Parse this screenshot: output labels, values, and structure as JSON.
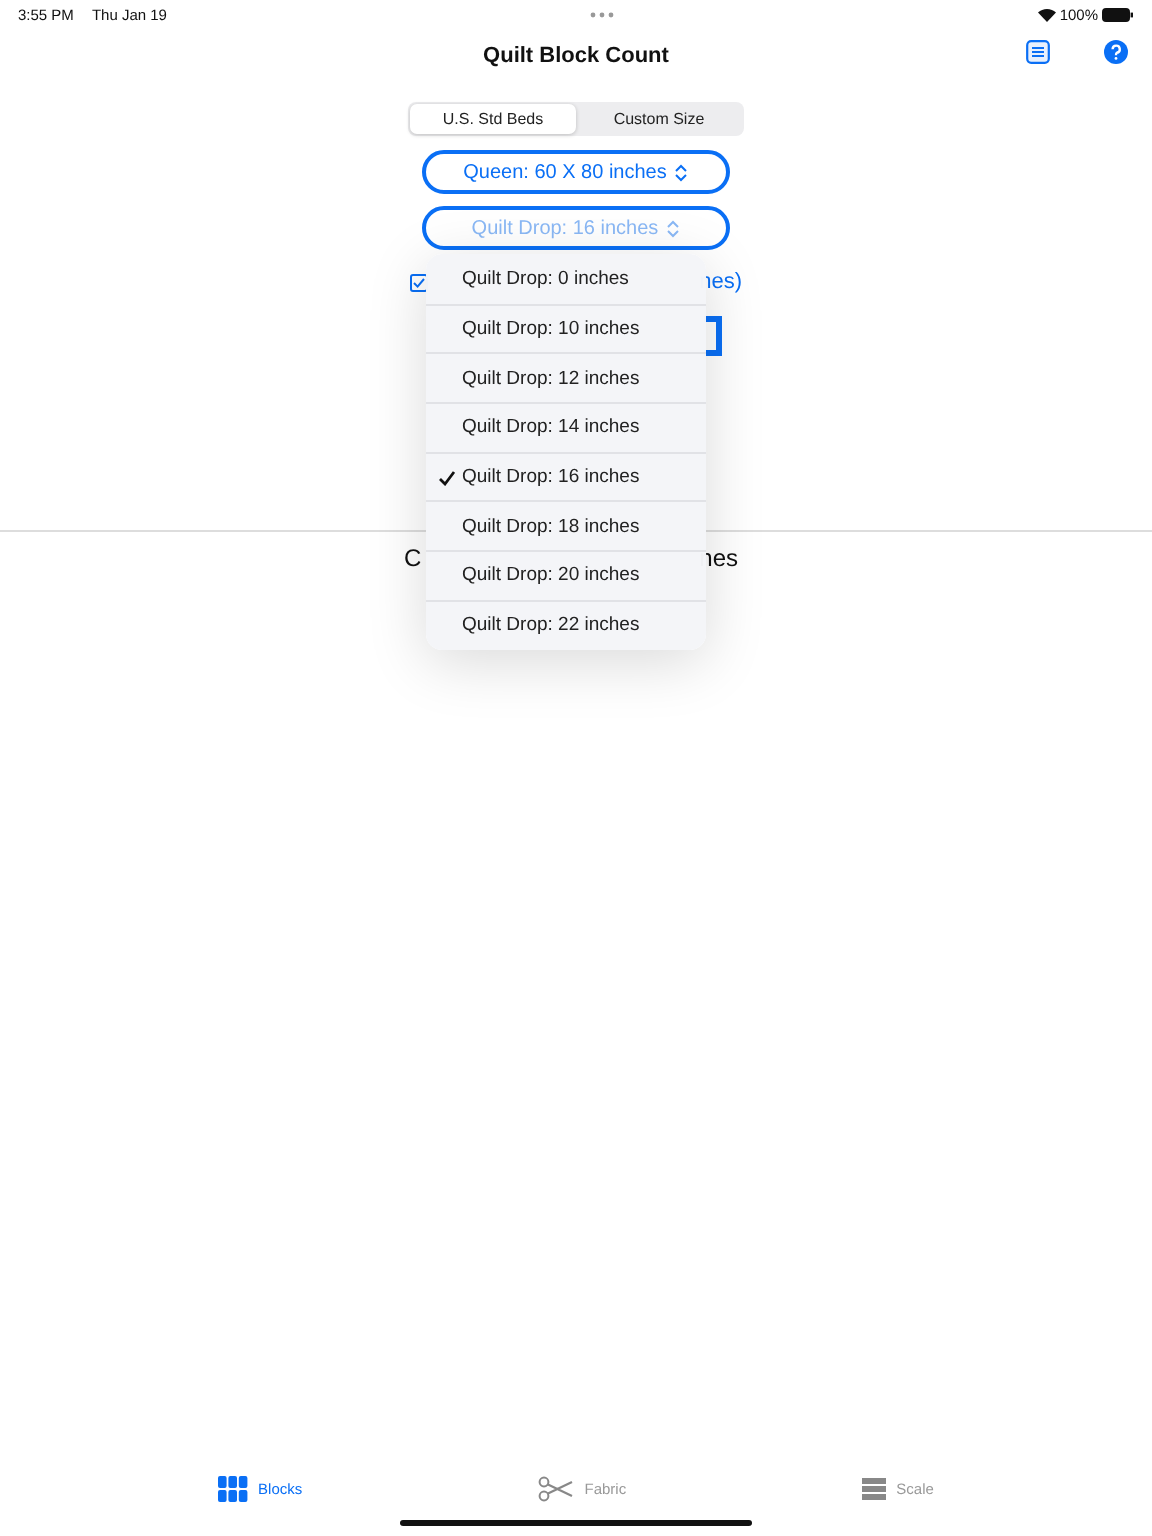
{
  "status_bar": {
    "time": "3:55 PM",
    "date": "Thu Jan 19",
    "battery": "100%"
  },
  "nav": {
    "title": "Quilt Block Count"
  },
  "segments": [
    {
      "label": "U.S. Std Beds",
      "selected": true
    },
    {
      "label": "Custom Size",
      "selected": false
    }
  ],
  "bed_button": {
    "label": "Queen: 60 X 80 inches"
  },
  "drop_button": {
    "label": "Quilt Drop: 16 inches"
  },
  "option": {
    "checked": true,
    "label_end": "nes)"
  },
  "result": {
    "start": "C",
    "end": "nes"
  },
  "menu": [
    {
      "label": "Quilt Drop: 0 inches",
      "selected": false
    },
    {
      "label": "Quilt Drop: 10 inches",
      "selected": false
    },
    {
      "label": "Quilt Drop: 12 inches",
      "selected": false
    },
    {
      "label": "Quilt Drop: 14 inches",
      "selected": false
    },
    {
      "label": "Quilt Drop: 16 inches",
      "selected": true
    },
    {
      "label": "Quilt Drop: 18 inches",
      "selected": false
    },
    {
      "label": "Quilt Drop: 20 inches",
      "selected": false
    },
    {
      "label": "Quilt Drop: 22 inches",
      "selected": false
    }
  ],
  "tabs": [
    {
      "label": "Blocks",
      "kind": "grid",
      "selected": true
    },
    {
      "label": "Fabric",
      "kind": "scissors",
      "selected": false
    },
    {
      "label": "Scale",
      "kind": "bars",
      "selected": false
    }
  ]
}
